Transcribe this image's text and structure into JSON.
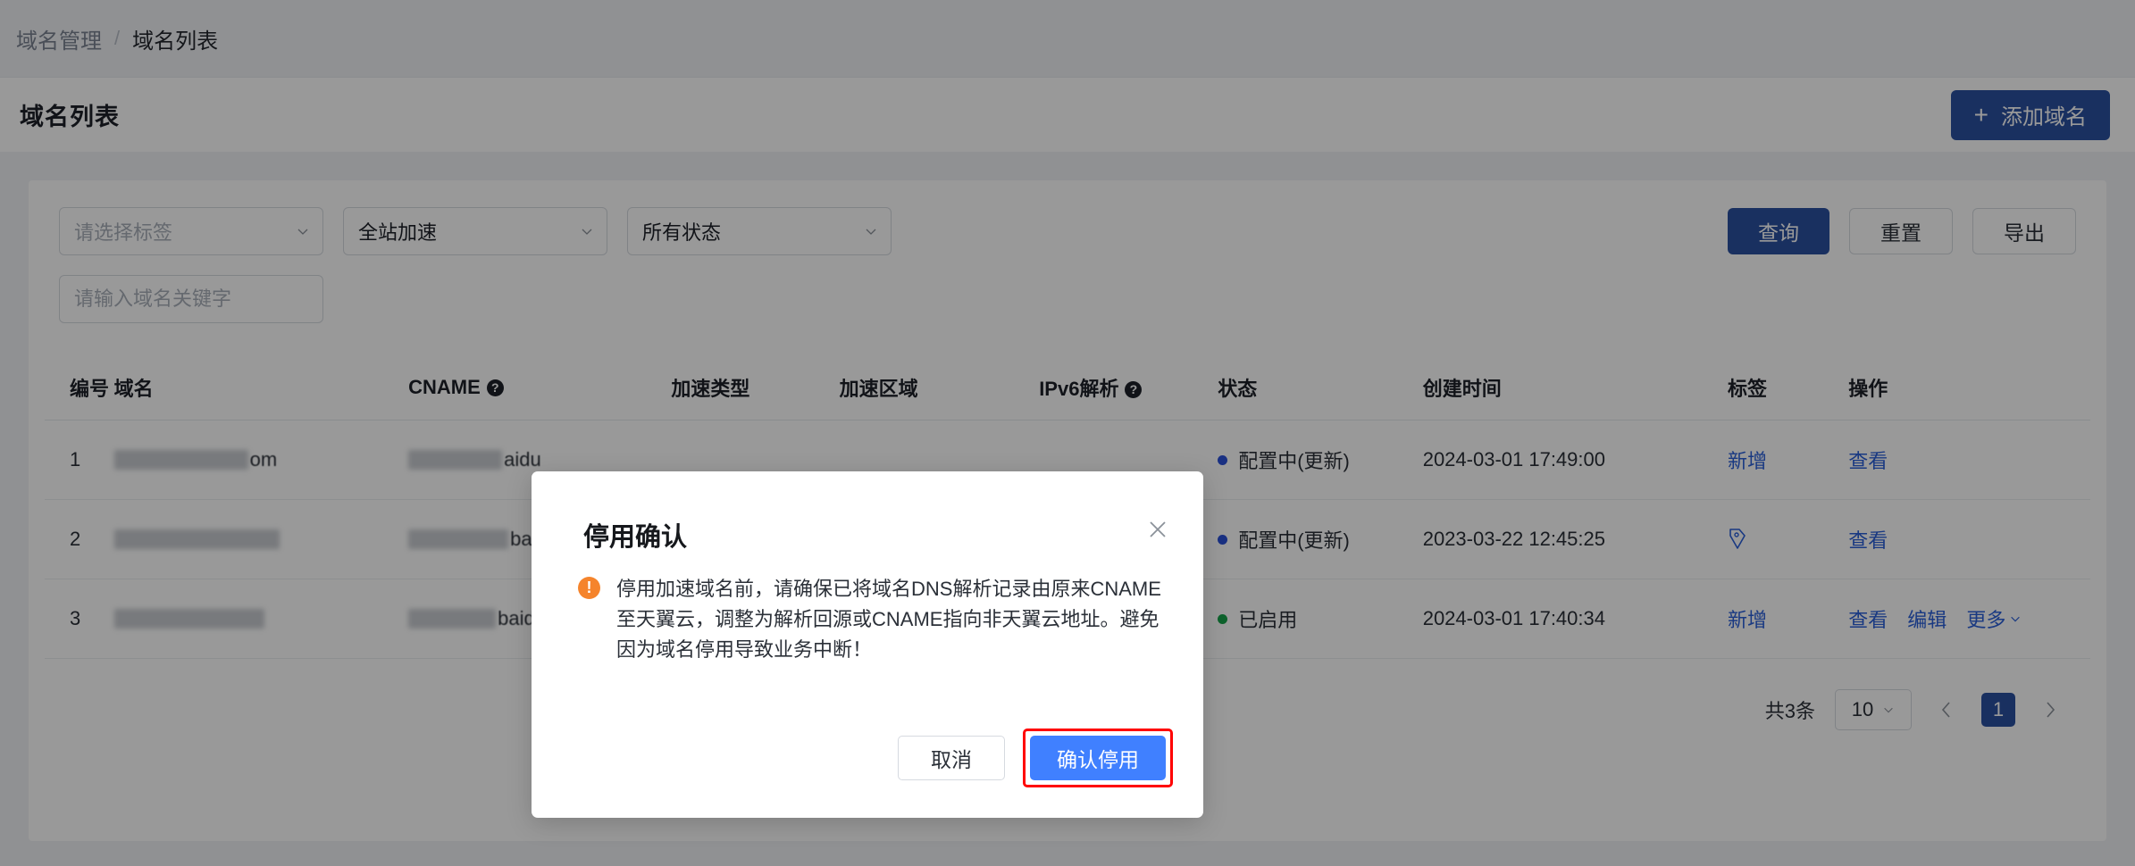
{
  "breadcrumb": {
    "parent": "域名管理",
    "separator": "/",
    "current": "域名列表"
  },
  "header": {
    "title": "域名列表",
    "add_button_label": "添加域名",
    "add_button_icon": "plus-icon",
    "add_button_color": "#2b50a1"
  },
  "filters": {
    "tag_select": {
      "value": "请选择标签",
      "is_placeholder": true
    },
    "type_select": {
      "value": "全站加速",
      "is_placeholder": false
    },
    "status_select": {
      "value": "所有状态",
      "is_placeholder": false
    },
    "keyword_input": {
      "value": "",
      "placeholder": "请输入域名关键字"
    },
    "query_label": "查询",
    "reset_label": "重置",
    "export_label": "导出"
  },
  "table": {
    "columns": [
      {
        "label": "编号",
        "help": false
      },
      {
        "label": "域名",
        "help": false
      },
      {
        "label": "CNAME",
        "help": true
      },
      {
        "label": "加速类型",
        "help": false
      },
      {
        "label": "加速区域",
        "help": false
      },
      {
        "label": "IPv6解析",
        "help": true
      },
      {
        "label": "状态",
        "help": false
      },
      {
        "label": "创建时间",
        "help": false
      },
      {
        "label": "标签",
        "help": false
      },
      {
        "label": "操作",
        "help": false
      }
    ],
    "rows": [
      {
        "no": "1",
        "domain_redacted": true,
        "domain_visible_tail": "om",
        "cname_redacted": true,
        "cname_visible_tail": "aidu",
        "type": "",
        "area": "",
        "ipv6": "",
        "status": {
          "text": "配置中(更新)",
          "color": "#2b50d9"
        },
        "created": "2024-03-01 17:49:00",
        "tag": {
          "kind": "text",
          "label": "新增"
        },
        "actions": [
          "查看"
        ]
      },
      {
        "no": "2",
        "domain_redacted": true,
        "domain_visible_tail": "",
        "cname_redacted": true,
        "cname_visible_tail": "ba",
        "type": "",
        "area": "",
        "ipv6": "",
        "status": {
          "text": "配置中(更新)",
          "color": "#2b50d9"
        },
        "created": "2023-03-22 12:45:25",
        "tag": {
          "kind": "icon",
          "label": "tag-icon"
        },
        "actions": [
          "查看"
        ]
      },
      {
        "no": "3",
        "domain_redacted": true,
        "domain_visible_tail": "",
        "cname_redacted": true,
        "cname_visible_tail": "baidu",
        "type": "",
        "area": "",
        "ipv6": "",
        "status": {
          "text": "已启用",
          "color": "#17a34a"
        },
        "created": "2024-03-01 17:40:34",
        "tag": {
          "kind": "text",
          "label": "新增"
        },
        "actions": [
          "查看",
          "编辑",
          "更多"
        ]
      }
    ]
  },
  "pagination": {
    "total_text": "共3条",
    "page_size": "10",
    "prev_icon": "chevron-left-icon",
    "next_icon": "chevron-right-icon",
    "current_page": "1"
  },
  "modal": {
    "title": "停用确认",
    "close_icon": "close-icon",
    "warn_icon": "warning-icon",
    "warn_color": "#f5842c",
    "message": "停用加速域名前，请确保已将域名DNS解析记录由原来CNAME至天翼云，调整为解析回源或CNAME指向非天翼云地址。避免因为域名停用导致业务中断！",
    "cancel_label": "取消",
    "confirm_label": "确认停用",
    "confirm_color": "#4080ff",
    "highlight_color": "#ff0000"
  }
}
